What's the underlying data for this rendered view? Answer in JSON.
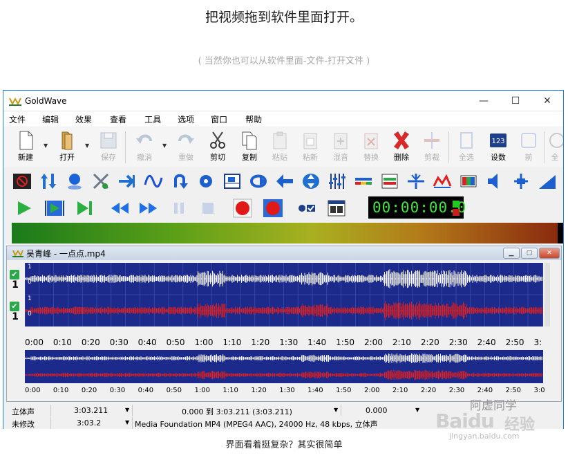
{
  "article": {
    "heading": "把视频拖到软件里面打开。",
    "subheading": "( 当然你也可以从软件里面-文件-打开文件 )",
    "caption": "界面看着挺复杂？其实很简单"
  },
  "watermark": {
    "logo": "Baidu",
    "jingyan": "经验",
    "author": "阿虚同学",
    "url": "jingyan.baidu.com"
  },
  "app": {
    "title": "GoldWave",
    "window_controls": {
      "minimize": "—",
      "maximize": "☐",
      "close": "✕"
    },
    "menu": [
      "文件",
      "编辑",
      "效果",
      "查看",
      "工具",
      "选项",
      "窗口",
      "帮助"
    ],
    "toolbar": [
      {
        "label": "新建",
        "icon": "new-file-icon",
        "enabled": true
      },
      {
        "label": "打开",
        "icon": "open-folder-icon",
        "enabled": true
      },
      {
        "label": "保存",
        "icon": "save-icon",
        "enabled": false
      },
      {
        "label": "撤消",
        "icon": "undo-icon",
        "enabled": false
      },
      {
        "label": "重做",
        "icon": "redo-icon",
        "enabled": false
      },
      {
        "label": "剪切",
        "icon": "cut-icon",
        "enabled": true
      },
      {
        "label": "复制",
        "icon": "copy-icon",
        "enabled": true
      },
      {
        "label": "粘贴",
        "icon": "paste-icon",
        "enabled": false
      },
      {
        "label": "粘新",
        "icon": "paste-new-icon",
        "enabled": false
      },
      {
        "label": "混音",
        "icon": "mix-icon",
        "enabled": false
      },
      {
        "label": "替换",
        "icon": "replace-icon",
        "enabled": false
      },
      {
        "label": "删除",
        "icon": "delete-icon",
        "enabled": true
      },
      {
        "label": "剪裁",
        "icon": "trim-icon",
        "enabled": false
      },
      {
        "label": "全选",
        "icon": "select-all-icon",
        "enabled": false
      },
      {
        "label": "设数",
        "icon": "set-marker-icon",
        "enabled": true
      },
      {
        "label": "前",
        "icon": "previous-icon",
        "enabled": false
      },
      {
        "label": "全",
        "icon": "all-icon",
        "enabled": false
      }
    ],
    "timer": "00:00:00.0",
    "document": {
      "title": "吴青峰 - 一点点.mp4",
      "channel_numbers": [
        "1",
        "1"
      ],
      "channel_scale": [
        "1",
        "0",
        "1",
        "0"
      ],
      "timeline_main": [
        "0:00",
        "0:10",
        "0:20",
        "0:30",
        "0:40",
        "0:50",
        "1:00",
        "1:10",
        "1:20",
        "1:30",
        "1:40",
        "1:50",
        "2:00",
        "2:10",
        "2:20",
        "2:30",
        "2:40",
        "2:50",
        "3:"
      ],
      "timeline_overview": [
        "0:00",
        "0:10",
        "0:20",
        "0:30",
        "0:40",
        "0:50",
        "1:00",
        "1:10",
        "1:20",
        "1:30",
        "1:40",
        "1:50",
        "2:00",
        "2:10",
        "2:20",
        "2:30",
        "2:40",
        "2:50",
        "3:0"
      ]
    },
    "status": {
      "row1": {
        "channels": "立体声",
        "length": "3:03.211",
        "selection": "0.000 到 3:03.211 (3:03.211)",
        "position": "0.000"
      },
      "row2": {
        "modified": "未修改",
        "duration": "3:03.2",
        "format": "Media Foundation MP4 (MPEG4 AAC), 24000 Hz, 48 kbps, 立体声"
      }
    },
    "colors": {
      "waveform_bg": "#1c2a8c",
      "left_channel": "#ffffff",
      "right_channel": "#e02020",
      "timer_text": "#3ee83e"
    }
  }
}
